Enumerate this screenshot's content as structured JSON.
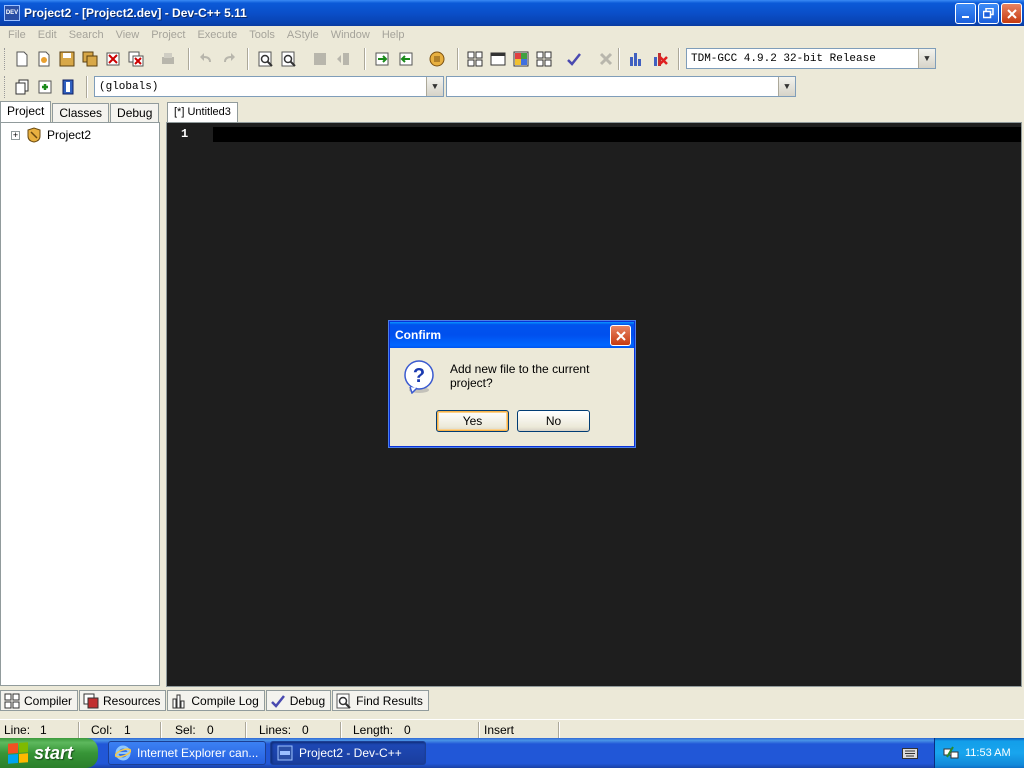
{
  "window": {
    "title": "Project2 - [Project2.dev] - Dev-C++ 5.11",
    "app_icon_text": "DEV"
  },
  "menu": [
    "File",
    "Edit",
    "Search",
    "View",
    "Project",
    "Execute",
    "Tools",
    "AStyle",
    "Window",
    "Help"
  ],
  "toolbar": {
    "compiler_select": "TDM-GCC 4.9.2 32-bit Release",
    "scope_select": "(globals)",
    "member_select": ""
  },
  "left_panel": {
    "tabs": [
      "Project",
      "Classes",
      "Debug"
    ],
    "tree": [
      {
        "label": "Project2",
        "expander": "+"
      }
    ]
  },
  "editor": {
    "tab_label": "[*] Untitled3",
    "line_numbers": [
      "1"
    ],
    "background": "#1e1e1e"
  },
  "bottom_tabs": [
    "Compiler",
    "Resources",
    "Compile Log",
    "Debug",
    "Find Results"
  ],
  "status": {
    "line_label": "Line:",
    "line_value": "1",
    "col_label": "Col:",
    "col_value": "1",
    "sel_label": "Sel:",
    "sel_value": "0",
    "lines_label": "Lines:",
    "lines_value": "0",
    "length_label": "Length:",
    "length_value": "0",
    "mode": "Insert"
  },
  "dialog": {
    "title": "Confirm",
    "message": "Add new file to the current project?",
    "yes_label": "Yes",
    "no_label": "No"
  },
  "taskbar": {
    "start_label": "start",
    "tasks": [
      {
        "label": "Internet Explorer can...",
        "icon": "ie-icon"
      },
      {
        "label": "Project2 - Dev-C++",
        "icon": "devcpp-icon"
      }
    ],
    "clock": "11:53 AM"
  },
  "colors": {
    "titlebar": "#0a4fc9",
    "editor_bg": "#1e1e1e",
    "taskbar": "#2157d7",
    "start_green": "#379537"
  }
}
